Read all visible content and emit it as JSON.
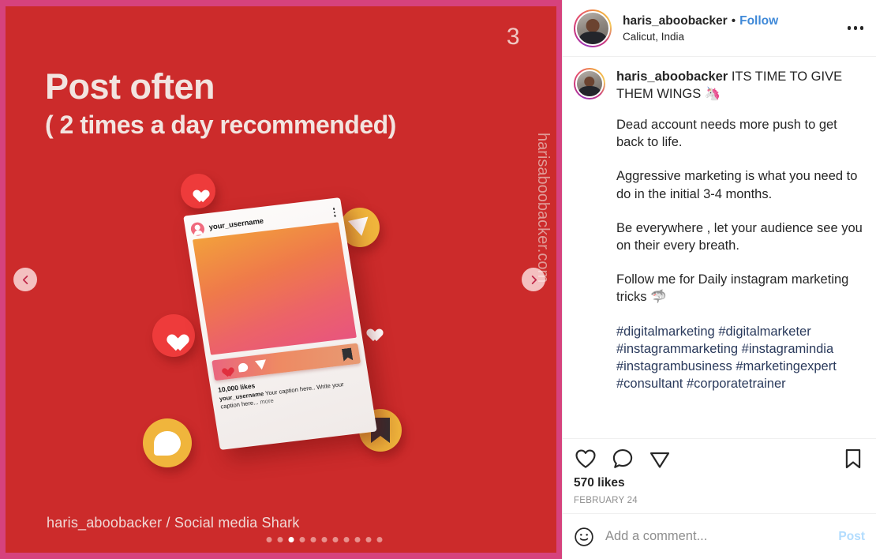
{
  "media": {
    "slide_number": "3",
    "headline_line1": "Post often",
    "headline_line2": "( 2 times a day recommended)",
    "watermark": "harisaboobacker.com",
    "bottom_credit": "haris_aboobacker / Social media Shark",
    "prev_arrow_icon": "chevron-left-icon",
    "next_arrow_icon": "chevron-right-icon",
    "carousel": {
      "total_dots": 11,
      "active_index": 2
    },
    "mockup": {
      "username": "your_username",
      "likes": "10,000 likes",
      "caption_user": "your_username",
      "caption_text": "Your caption here.. Write your caption here...",
      "more_label": "more",
      "icons": [
        "heart-icon",
        "comment-icon",
        "share-icon",
        "bookmark-icon"
      ],
      "floating_icons": [
        "heart-icon",
        "heart-icon",
        "heart-icon",
        "share-icon",
        "comment-icon",
        "bookmark-icon"
      ]
    },
    "colors": {
      "background": "#cc2b2b",
      "frame": "#d6427d",
      "headline": "#f2e4e0"
    }
  },
  "header": {
    "username": "haris_aboobacker",
    "separator": "•",
    "follow_label": "Follow",
    "location": "Calicut, India",
    "more_icon": "more-options-icon",
    "avatar_icon": "avatar"
  },
  "caption": {
    "username": "haris_aboobacker",
    "title": "ITS TIME TO GIVE THEM WINGS 🦄",
    "paragraphs": [
      "Dead account needs more push to get back to life.",
      "Aggressive marketing is what you need to do in the initial 3-4 months.",
      "Be everywhere , let your audience see you on their every breath.",
      "Follow me for Daily instagram marketing tricks 🦈"
    ],
    "hashtags": "#digitalmarketing #digitalmarketer #instagrammarketing #instagramindia #instagrambusiness #marketingexpert #consultant #corporatetrainer"
  },
  "actions": {
    "like_icon": "heart-icon",
    "comment_icon": "comment-icon",
    "share_icon": "share-icon",
    "save_icon": "bookmark-icon",
    "likes": "570 likes",
    "date": "FEBRUARY 24"
  },
  "comment_box": {
    "emoji_icon": "smiley-icon",
    "placeholder": "Add a comment...",
    "value": "",
    "post_label": "Post"
  }
}
